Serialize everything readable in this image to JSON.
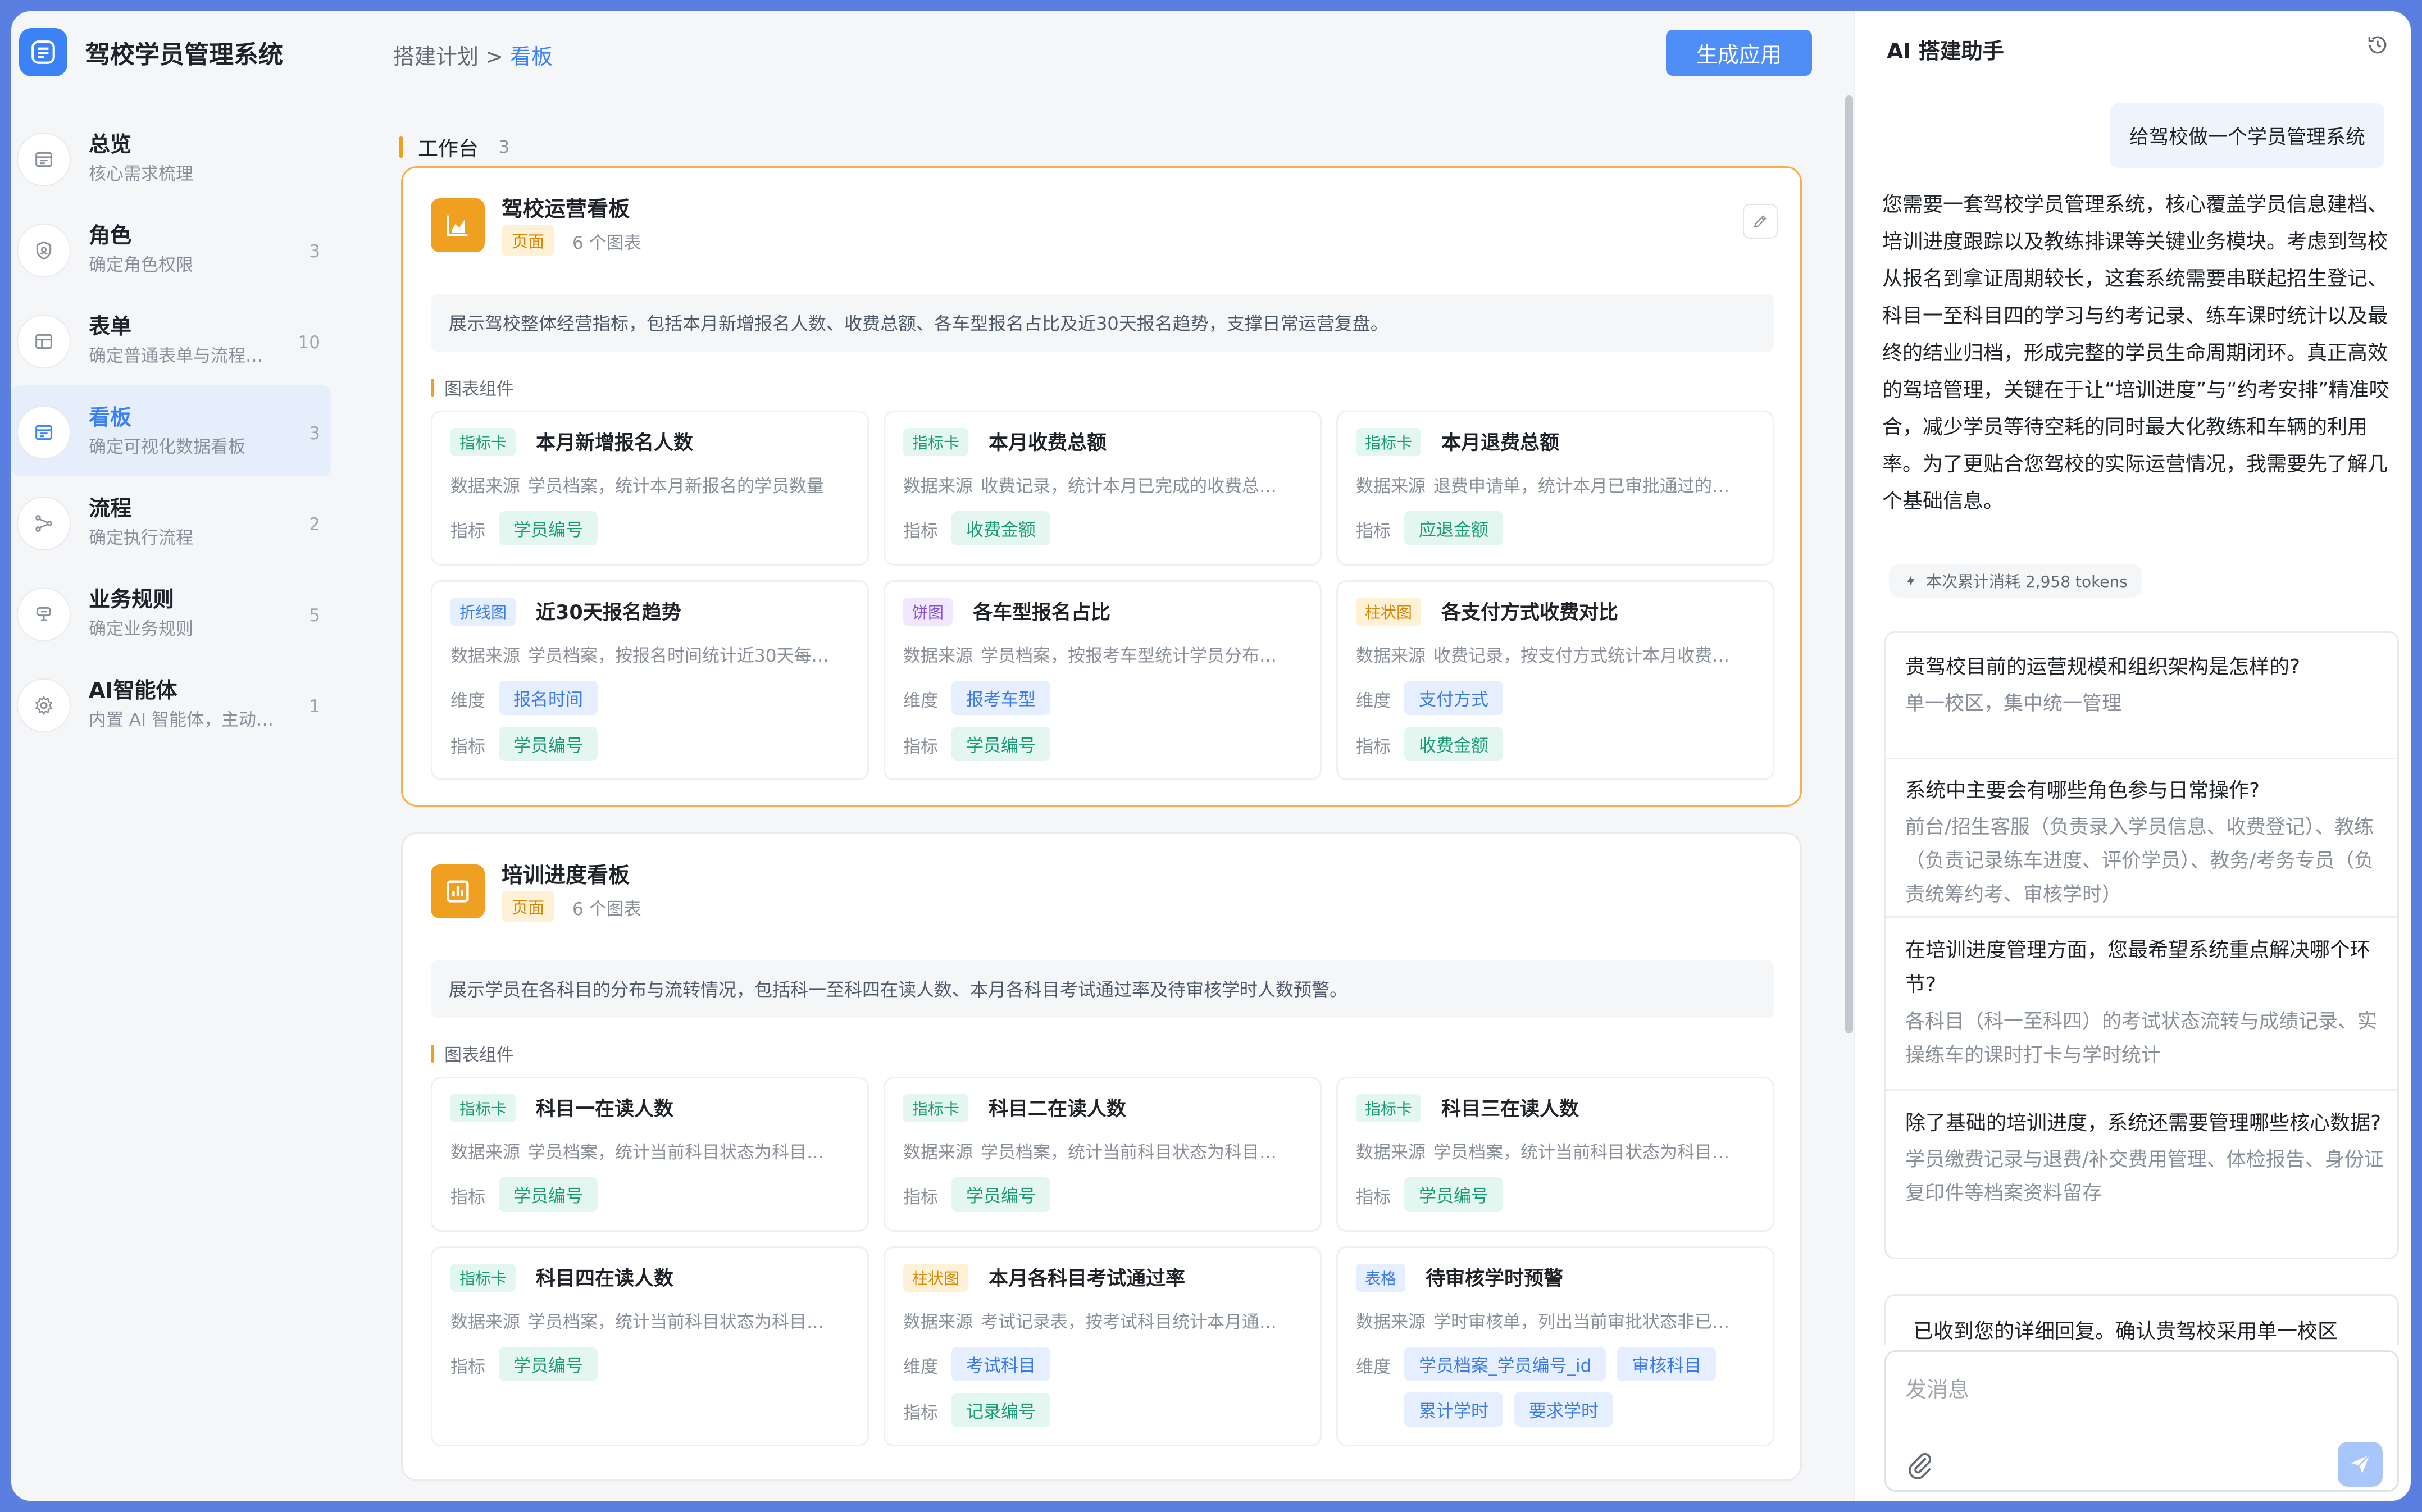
{
  "app": {
    "title": "驾校学员管理系统"
  },
  "sidebar": {
    "items": [
      {
        "title": "总览",
        "sub": "核心需求梳理",
        "count": "",
        "icon": "overview-icon"
      },
      {
        "title": "角色",
        "sub": "确定角色权限",
        "count": "3",
        "icon": "shield-icon"
      },
      {
        "title": "表单",
        "sub": "确定普通表单与流程…",
        "count": "10",
        "icon": "table-icon"
      },
      {
        "title": "看板",
        "sub": "确定可视化数据看板",
        "count": "3",
        "icon": "dashboard-icon"
      },
      {
        "title": "流程",
        "sub": "确定执行流程",
        "count": "2",
        "icon": "flow-icon"
      },
      {
        "title": "业务规则",
        "sub": "确定业务规则",
        "count": "5",
        "icon": "rule-icon"
      },
      {
        "title": "AI智能体",
        "sub": "内置 AI 智能体，主动…",
        "count": "1",
        "icon": "gear-icon"
      }
    ]
  },
  "header": {
    "crumb_parent": "搭建计划 >",
    "crumb_current": "看板",
    "generate_label": "生成应用"
  },
  "workspace": {
    "title": "工作台",
    "count": "3"
  },
  "boards": [
    {
      "title": "驾校运营看板",
      "tag": "页面",
      "chart_count": "6 个图表",
      "desc": "展示驾校整体经营指标，包括本月新增报名人数、收费总额、各车型报名占比及近30天报名趋势，支撑日常运营复盘。",
      "sub_title": "图表组件",
      "cards": [
        {
          "type": "指标卡",
          "title": "本月新增报名人数",
          "src_label": "数据来源",
          "src": "学员档案，统计本月新报名的学员数量",
          "f1_label": "指标",
          "f1": [
            "学员编号"
          ]
        },
        {
          "type": "指标卡",
          "title": "本月收费总额",
          "src_label": "数据来源",
          "src": "收费记录，统计本月已完成的收费总…",
          "f1_label": "指标",
          "f1": [
            "收费金额"
          ]
        },
        {
          "type": "指标卡",
          "title": "本月退费总额",
          "src_label": "数据来源",
          "src": "退费申请单，统计本月已审批通过的…",
          "f1_label": "指标",
          "f1": [
            "应退金额"
          ]
        },
        {
          "type": "折线图",
          "title": "近30天报名趋势",
          "src_label": "数据来源",
          "src": "学员档案，按报名时间统计近30天每…",
          "f1_label": "维度",
          "f1": [
            "报名时间"
          ],
          "f2_label": "指标",
          "f2": [
            "学员编号"
          ]
        },
        {
          "type": "饼图",
          "title": "各车型报名占比",
          "src_label": "数据来源",
          "src": "学员档案，按报考车型统计学员分布…",
          "f1_label": "维度",
          "f1": [
            "报考车型"
          ],
          "f2_label": "指标",
          "f2": [
            "学员编号"
          ]
        },
        {
          "type": "柱状图",
          "title": "各支付方式收费对比",
          "src_label": "数据来源",
          "src": "收费记录，按支付方式统计本月收费…",
          "f1_label": "维度",
          "f1": [
            "支付方式"
          ],
          "f2_label": "指标",
          "f2": [
            "收费金额"
          ]
        }
      ]
    },
    {
      "title": "培训进度看板",
      "tag": "页面",
      "chart_count": "6 个图表",
      "desc": "展示学员在各科目的分布与流转情况，包括科一至科四在读人数、本月各科目考试通过率及待审核学时人数预警。",
      "sub_title": "图表组件",
      "cards": [
        {
          "type": "指标卡",
          "title": "科目一在读人数",
          "src_label": "数据来源",
          "src": "学员档案，统计当前科目状态为科目…",
          "f1_label": "指标",
          "f1": [
            "学员编号"
          ]
        },
        {
          "type": "指标卡",
          "title": "科目二在读人数",
          "src_label": "数据来源",
          "src": "学员档案，统计当前科目状态为科目…",
          "f1_label": "指标",
          "f1": [
            "学员编号"
          ]
        },
        {
          "type": "指标卡",
          "title": "科目三在读人数",
          "src_label": "数据来源",
          "src": "学员档案，统计当前科目状态为科目…",
          "f1_label": "指标",
          "f1": [
            "学员编号"
          ]
        },
        {
          "type": "指标卡",
          "title": "科目四在读人数",
          "src_label": "数据来源",
          "src": "学员档案，统计当前科目状态为科目…",
          "f1_label": "指标",
          "f1": [
            "学员编号"
          ]
        },
        {
          "type": "柱状图",
          "title": "本月各科目考试通过率",
          "src_label": "数据来源",
          "src": "考试记录表，按考试科目统计本月通…",
          "f1_label": "维度",
          "f1": [
            "考试科目"
          ],
          "f2_label": "指标",
          "f2": [
            "记录编号"
          ]
        },
        {
          "type": "表格",
          "title": "待审核学时预警",
          "src_label": "数据来源",
          "src": "学时审核单，列出当前审批状态非已…",
          "f1_label": "维度",
          "f1": [
            "学员档案_学员编号_id",
            "审核科目",
            "累计学时",
            "要求学时"
          ]
        }
      ]
    }
  ],
  "assistant": {
    "title": "AI 搭建助手",
    "user_msg": "给驾校做一个学员管理系统",
    "ai_msg": "您需要一套驾校学员管理系统，核心覆盖学员信息建档、培训进度跟踪以及教练排课等关键业务模块。考虑到驾校从报名到拿证周期较长，这套系统需要串联起招生登记、科目一至科目四的学习与约考记录、练车课时统计以及最终的结业归档，形成完整的学员生命周期闭环。真正高效的驾培管理，关键在于让“培训进度”与“约考安排”精准咬合，减少学员等待空耗的同时最大化教练和车辆的利用率。为了更贴合您驾校的实际运营情况，我需要先了解几个基础信息。",
    "tokens": "本次累计消耗 2,958 tokens",
    "qa": [
      {
        "q": "贵驾校目前的运营规模和组织架构是怎样的?",
        "a": "单一校区，集中统一管理"
      },
      {
        "q": "系统中主要会有哪些角色参与日常操作?",
        "a": "前台/招生客服（负责录入学员信息、收费登记）、教练（负责记录练车进度、评价学员）、教务/考务专员（负责统筹约考、审核学时）"
      },
      {
        "q": "在培训进度管理方面，您最希望系统重点解决哪个环节?",
        "a": "各科目（科一至科四）的考试状态流转与成绩记录、实操练车的课时打卡与学时统计"
      },
      {
        "q": "除了基础的培训进度，系统还需要管理哪些核心数据?",
        "a": "学员缴费记录与退费/补交费用管理、体检报告、身份证复印件等档案资料留存"
      }
    ],
    "ack": "已收到您的详细回复。确认贵驾校采用单一校区",
    "composer_placeholder": "发消息"
  }
}
